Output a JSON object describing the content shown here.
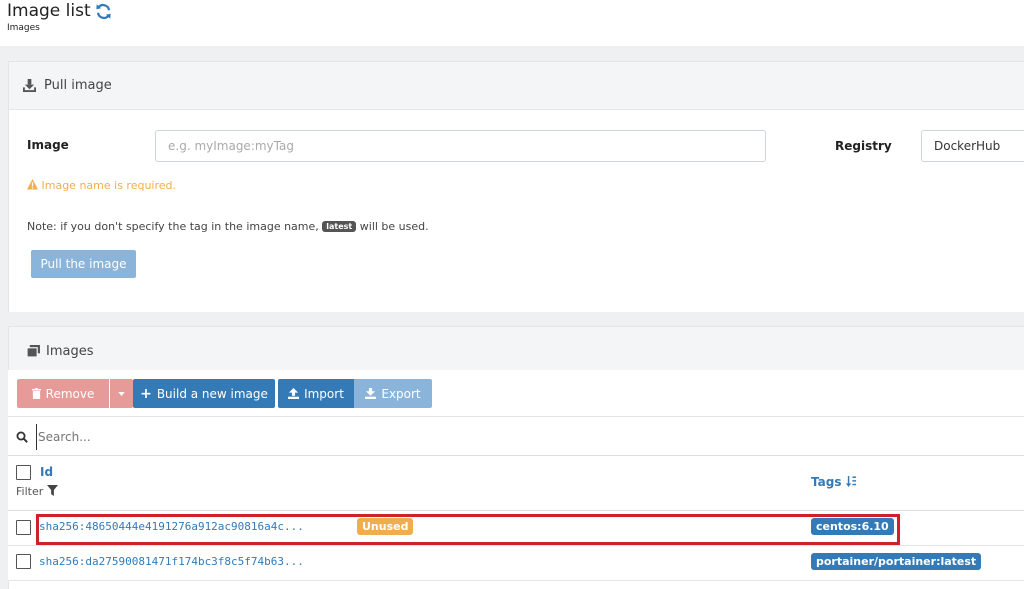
{
  "header": {
    "title": "Image list",
    "breadcrumb": "Images"
  },
  "pull_panel": {
    "title": "Pull image",
    "image_label": "Image",
    "image_value": "",
    "image_placeholder": "e.g. myImage:myTag",
    "registry_label": "Registry",
    "registry_value": "DockerHub",
    "warning": "Image name is required.",
    "note_prefix": "Note: if you don't specify the tag in the image name,",
    "note_tag": "latest",
    "note_suffix": "will be used.",
    "pull_button": "Pull the image"
  },
  "images_panel": {
    "title": "Images",
    "buttons": {
      "remove": "Remove",
      "build": "Build a new image",
      "import": "Import",
      "export": "Export"
    },
    "search_placeholder": "Search...",
    "columns": {
      "id": "Id",
      "filter": "Filter",
      "tags": "Tags"
    },
    "rows": [
      {
        "id": "sha256:48650444e4191276a912ac90816a4c...",
        "unused_badge": "Unused",
        "tag": "centos:6.10"
      },
      {
        "id": "sha256:da27590081471f174bc3f8c5f74b63...",
        "tag": "portainer/portainer:latest"
      }
    ]
  },
  "colors": {
    "primary": "#337ab7",
    "danger_disabled": "#e79b98",
    "warning": "#f0ad4e",
    "highlight": "#d0202c"
  }
}
